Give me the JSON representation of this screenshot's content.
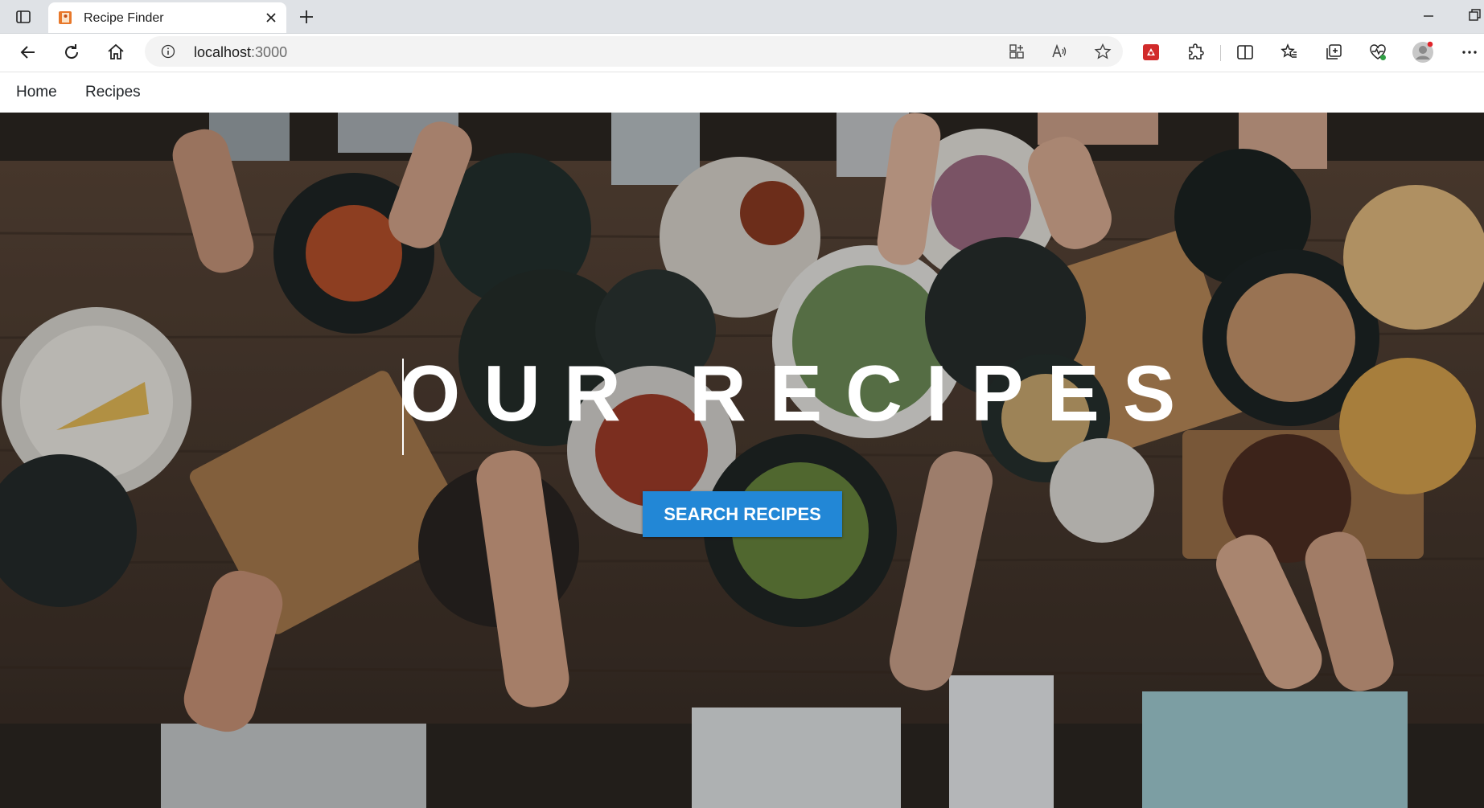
{
  "browser": {
    "tab": {
      "title": "Recipe Finder",
      "favicon": "recipe-book-icon"
    },
    "address": {
      "host": "localhost",
      "port": ":3000"
    },
    "toolbar_icons": [
      "back-icon",
      "refresh-icon",
      "home-icon",
      "info-icon",
      "app-available-icon",
      "read-aloud-icon",
      "favorite-star-icon",
      "extension-red-icon",
      "extensions-icon",
      "split-screen-icon",
      "favorites-icon",
      "collections-icon",
      "browser-essentials-icon",
      "profile-avatar-icon",
      "more-menu-icon"
    ]
  },
  "nav": {
    "links": [
      {
        "label": "Home"
      },
      {
        "label": "Recipes"
      }
    ]
  },
  "hero": {
    "title": "OUR RECIPES",
    "button_label": "SEARCH RECIPES",
    "image": "overhead photo of people sharing dishes on a wooden table"
  },
  "colors": {
    "accent": "#2287d6",
    "tabbar": "#dfe2e6",
    "table_wood": "#4a3a2e"
  }
}
